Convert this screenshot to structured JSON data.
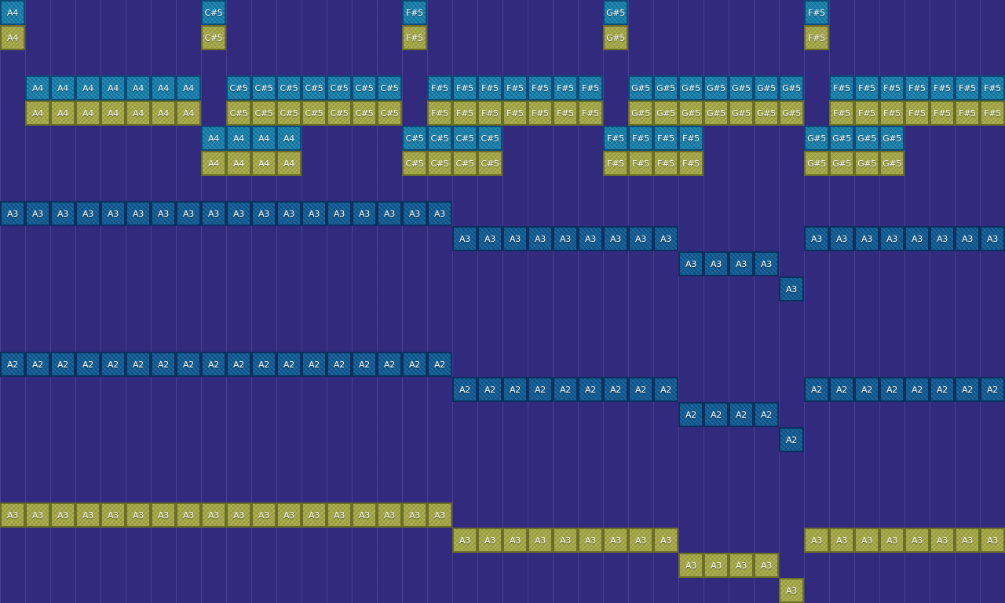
{
  "colors": {
    "background": "#322a7c",
    "cyan": "#157eaa",
    "olive": "#a4a845",
    "navy": "#0f5a92"
  },
  "notes": [
    {
      "label": "A4",
      "style": "cyan",
      "col": 0,
      "row": 0,
      "count": 1
    },
    {
      "label": "C#5",
      "style": "cyan",
      "col": 8,
      "row": 0,
      "count": 1
    },
    {
      "label": "F#5",
      "style": "cyan",
      "col": 16,
      "row": 0,
      "count": 1
    },
    {
      "label": "G#5",
      "style": "cyan",
      "col": 24,
      "row": 0,
      "count": 1
    },
    {
      "label": "F#5",
      "style": "cyan",
      "col": 32,
      "row": 0,
      "count": 1
    },
    {
      "label": "A4",
      "style": "olive",
      "col": 0,
      "row": 1,
      "count": 1
    },
    {
      "label": "C#5",
      "style": "olive",
      "col": 8,
      "row": 1,
      "count": 1
    },
    {
      "label": "F#5",
      "style": "olive",
      "col": 16,
      "row": 1,
      "count": 1
    },
    {
      "label": "G#5",
      "style": "olive",
      "col": 24,
      "row": 1,
      "count": 1
    },
    {
      "label": "F#5",
      "style": "olive",
      "col": 32,
      "row": 1,
      "count": 1
    },
    {
      "label": "A4",
      "style": "cyan",
      "col": 1,
      "row": 3,
      "count": 7
    },
    {
      "label": "C#5",
      "style": "cyan",
      "col": 9,
      "row": 3,
      "count": 7
    },
    {
      "label": "F#5",
      "style": "cyan",
      "col": 17,
      "row": 3,
      "count": 7
    },
    {
      "label": "G#5",
      "style": "cyan",
      "col": 25,
      "row": 3,
      "count": 7
    },
    {
      "label": "F#5",
      "style": "cyan",
      "col": 33,
      "row": 3,
      "count": 7
    },
    {
      "label": "A4",
      "style": "olive",
      "col": 1,
      "row": 4,
      "count": 7
    },
    {
      "label": "C#5",
      "style": "olive",
      "col": 9,
      "row": 4,
      "count": 7
    },
    {
      "label": "F#5",
      "style": "olive",
      "col": 17,
      "row": 4,
      "count": 7
    },
    {
      "label": "G#5",
      "style": "olive",
      "col": 25,
      "row": 4,
      "count": 7
    },
    {
      "label": "F#5",
      "style": "olive",
      "col": 33,
      "row": 4,
      "count": 7
    },
    {
      "label": "A4",
      "style": "cyan",
      "col": 8,
      "row": 5,
      "count": 4
    },
    {
      "label": "C#5",
      "style": "cyan",
      "col": 16,
      "row": 5,
      "count": 4
    },
    {
      "label": "F#5",
      "style": "cyan",
      "col": 24,
      "row": 5,
      "count": 4
    },
    {
      "label": "G#5",
      "style": "cyan",
      "col": 32,
      "row": 5,
      "count": 4
    },
    {
      "label": "A4",
      "style": "olive",
      "col": 8,
      "row": 6,
      "count": 4
    },
    {
      "label": "C#5",
      "style": "olive",
      "col": 16,
      "row": 6,
      "count": 4
    },
    {
      "label": "F#5",
      "style": "olive",
      "col": 24,
      "row": 6,
      "count": 4
    },
    {
      "label": "G#5",
      "style": "olive",
      "col": 32,
      "row": 6,
      "count": 4
    },
    {
      "label": "A3",
      "style": "navy",
      "col": 0,
      "row": 8,
      "count": 18
    },
    {
      "label": "A3",
      "style": "navy",
      "col": 18,
      "row": 9,
      "count": 9
    },
    {
      "label": "A3",
      "style": "navy",
      "col": 32,
      "row": 9,
      "count": 8
    },
    {
      "label": "A3",
      "style": "navy",
      "col": 27,
      "row": 10,
      "count": 4
    },
    {
      "label": "A3",
      "style": "navy",
      "col": 31,
      "row": 11,
      "count": 1
    },
    {
      "label": "A2",
      "style": "navy",
      "col": 0,
      "row": 14,
      "count": 18
    },
    {
      "label": "A2",
      "style": "navy",
      "col": 18,
      "row": 15,
      "count": 9
    },
    {
      "label": "A2",
      "style": "navy",
      "col": 32,
      "row": 15,
      "count": 8
    },
    {
      "label": "A2",
      "style": "navy",
      "col": 27,
      "row": 16,
      "count": 4
    },
    {
      "label": "A2",
      "style": "navy",
      "col": 31,
      "row": 17,
      "count": 1
    },
    {
      "label": "A3",
      "style": "olive",
      "col": 0,
      "row": 20,
      "count": 18
    },
    {
      "label": "A3",
      "style": "olive",
      "col": 18,
      "row": 21,
      "count": 9
    },
    {
      "label": "A3",
      "style": "olive",
      "col": 32,
      "row": 21,
      "count": 8
    },
    {
      "label": "A3",
      "style": "olive",
      "col": 27,
      "row": 22,
      "count": 4
    },
    {
      "label": "A3",
      "style": "olive",
      "col": 31,
      "row": 23,
      "count": 1
    }
  ]
}
